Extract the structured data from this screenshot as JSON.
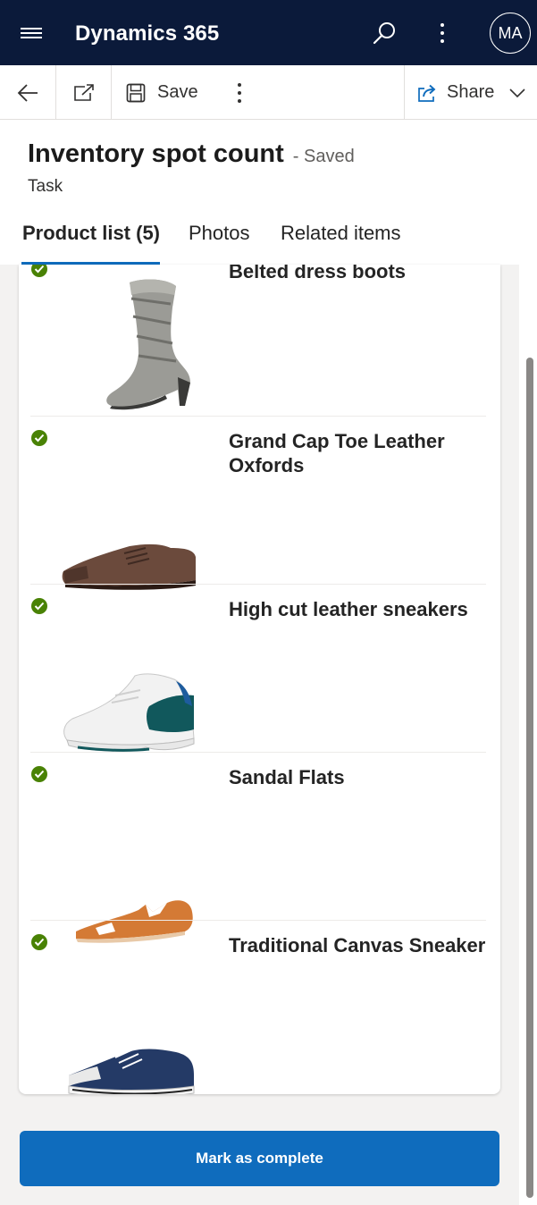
{
  "app": {
    "title": "Dynamics 365",
    "user_initials": "MA",
    "nav_icon": "hamburger-icon",
    "search_icon": "search-icon",
    "more_icon": "more-vertical-icon"
  },
  "command_bar": {
    "back_icon": "back-arrow-icon",
    "popout_icon": "open-in-new-window-icon",
    "save_label": "Save",
    "save_icon": "save-icon",
    "overflow_icon": "more-vertical-icon",
    "share_label": "Share",
    "share_icon": "share-icon",
    "share_chevron_icon": "chevron-down-icon"
  },
  "record": {
    "title": "Inventory spot count",
    "status": "- Saved",
    "entity_type": "Task"
  },
  "tabs": [
    {
      "label": "Product list (5)",
      "active": true
    },
    {
      "label": "Photos",
      "active": false
    },
    {
      "label": "Related items",
      "active": false
    }
  ],
  "products": [
    {
      "name": "Belted dress boots",
      "checked": true,
      "image": "grey-boot-image"
    },
    {
      "name": "Grand Cap Toe Leather Oxfords",
      "checked": true,
      "image": "brown-oxford-image"
    },
    {
      "name": "High cut leather sneakers",
      "checked": true,
      "image": "white-teal-sneaker-image"
    },
    {
      "name": "Sandal Flats",
      "checked": true,
      "image": "orange-sandal-image"
    },
    {
      "name": "Traditional Canvas Sneaker",
      "checked": true,
      "image": "navy-canvas-sneaker-image"
    }
  ],
  "actions": {
    "mark_complete_label": "Mark as complete"
  },
  "colors": {
    "appbar_bg": "#0b1a3a",
    "accent": "#0f6cbd",
    "check_green": "#498205"
  }
}
